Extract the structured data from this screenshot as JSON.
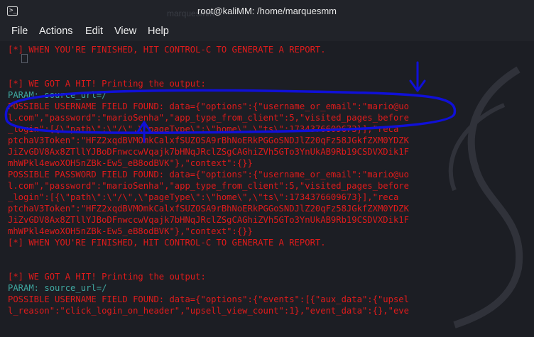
{
  "window": {
    "title": "root@kaliMM: /home/marquesmm",
    "ghost_title": "marquesmm"
  },
  "menu": {
    "items": [
      "File",
      "Actions",
      "Edit",
      "View",
      "Help"
    ]
  },
  "terminal": {
    "lines": [
      "[*] WHEN YOU'RE FINISHED, HIT CONTROL-C TO GENERATE A REPORT.",
      "",
      "",
      "[*] WE GOT A HIT! Printing the output:",
      "PARAM: source_url=/",
      "POSSIBLE USERNAME FIELD FOUND: data={\"options\":{\"username_or_email\":\"mario@uo",
      "l.com\",\"password\":\"marioSenha\",\"app_type_from_client\":5,\"visited_pages_before",
      "_login\":[{\\\"path\\\":\\\"/\\\",\\\"pageType\\\":\\\"home\\\",\\\"ts\\\":1734376609673}],\"reca",
      "ptchaV3Token\":\"HFZ2xqdBVMOmkCalxfSUZOSA9rBhNoERkPGGoSNDJlZ20qFz58JGkfZXM0YDZK",
      "JiZvGDV8Ax8ZTllYJBoDFnwccwVqajk7bHNqJRclZSgCAGhiZVh5GTo3YnUkAB9Rb19CSDVXDik1F",
      "mhWPkl4ewoXOH5nZBk-Ew5_eB8odBVK\"},\"context\":{}}",
      "POSSIBLE PASSWORD FIELD FOUND: data={\"options\":{\"username_or_email\":\"mario@uo",
      "l.com\",\"password\":\"marioSenha\",\"app_type_from_client\":5,\"visited_pages_before",
      "_login\":[{\\\"path\\\":\\\"/\\\",\\\"pageType\\\":\\\"home\\\",\\\"ts\\\":1734376609673}],\"reca",
      "ptchaV3Token\":\"HFZ2xqdBVMOmkCalxfSUZOSA9rBhNoERkPGGoSNDJlZ20qFz58JGkfZXM0YDZK",
      "JiZvGDV8Ax8ZTllYJBoDFnwccwVqajk7bHNqJRclZSgCAGhiZVh5GTo3YnUkAB9Rb19CSDVXDik1F",
      "mhWPkl4ewoXOH5nZBk-Ew5_eB8odBVK\"},\"context\":{}}",
      "[*] WHEN YOU'RE FINISHED, HIT CONTROL-C TO GENERATE A REPORT.",
      "",
      "",
      "[*] WE GOT A HIT! Printing the output:",
      "PARAM: source_url=/",
      "POSSIBLE USERNAME FIELD FOUND: data={\"options\":{\"events\":[{\"aux_data\":{\"upsel",
      "l_reason\":\"click_login_on_header\",\"upsell_view_count\":1},\"event_data\":{},\"eve"
    ],
    "line_colors": [
      "red",
      "red",
      "red",
      "red",
      "cyan",
      "red",
      "red",
      "red",
      "red",
      "red",
      "red",
      "red",
      "red",
      "red",
      "red",
      "red",
      "red",
      "red",
      "red",
      "red",
      "red",
      "cyan",
      "red",
      "red"
    ],
    "ghost_prompt": "─$"
  },
  "colors": {
    "text_red": "#e01b1b",
    "text_cyan": "#3fa7a0",
    "annotation_blue": "#1010d8",
    "background": "#1c1e24"
  }
}
